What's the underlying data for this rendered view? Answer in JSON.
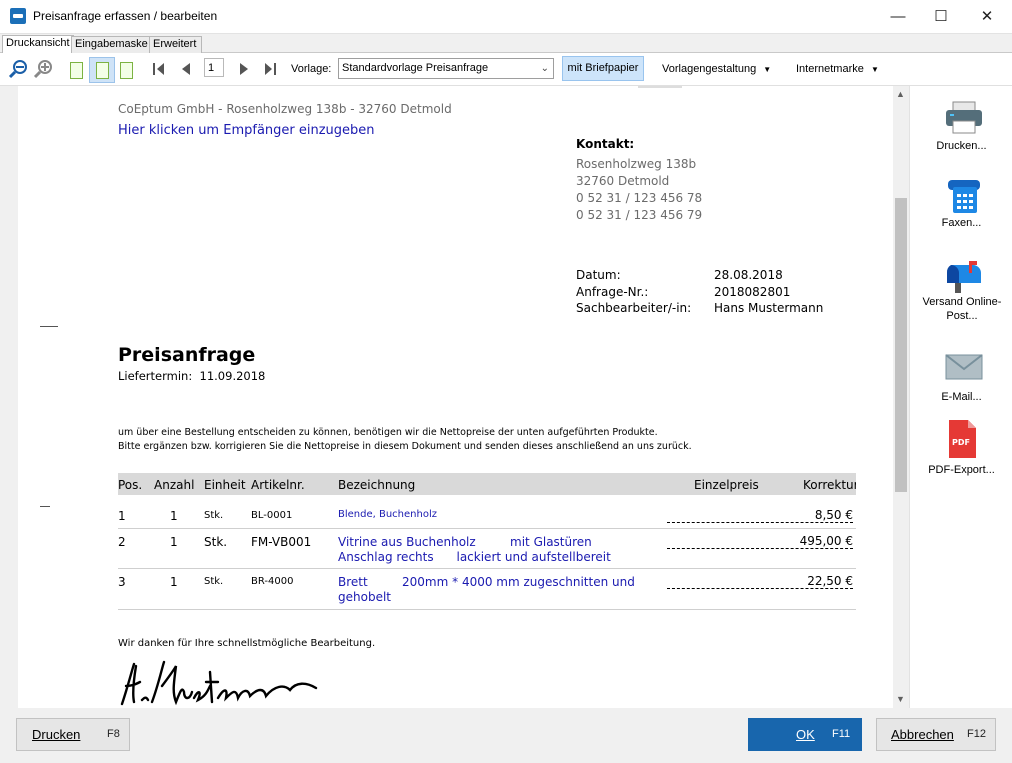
{
  "window": {
    "title": "Preisanfrage  erfassen / bearbeiten"
  },
  "tabs": [
    {
      "label": "Druckansicht"
    },
    {
      "label": "Eingabemaske"
    },
    {
      "label": "Erweitert"
    }
  ],
  "toolbar": {
    "page_number": "1",
    "vorlage_label": "Vorlage:",
    "vorlage_value": "Standardvorlage Preisanfrage",
    "briefpapier_label": "mit Briefpapier",
    "vorlagengestaltung_label": "Vorlagengestaltung",
    "internetmarke_label": "Internetmarke"
  },
  "document": {
    "sender_line": "CoEptum GmbH - Rosenholzweg 138b - 32760 Detmold",
    "recipient_placeholder": "Hier klicken um Empfänger einzugeben",
    "kontakt": {
      "title": "Kontakt:",
      "lines": [
        "Rosenholzweg 138b",
        "32760 Detmold",
        "0 52 31 / 123 456 78",
        "0 52 31 / 123 456 79"
      ]
    },
    "meta": [
      {
        "label": "Datum:",
        "value": "28.08.2018"
      },
      {
        "label": "Anfrage-Nr.:",
        "value": "2018082801"
      },
      {
        "label": "Sachbearbeiter/-in:",
        "value": "Hans Mustermann"
      }
    ],
    "heading": "Preisanfrage",
    "liefertermin_label": "Liefertermin:",
    "liefertermin_value": "11.09.2018",
    "intro_lines": [
      "um über eine Bestellung entscheiden zu können, benötigen wir die Nettopreise der unten aufgeführten Produkte.",
      "Bitte ergänzen bzw. korrigieren Sie die Nettopreise in diesem Dokument und senden dieses anschließend an uns zurück."
    ],
    "table": {
      "headers": [
        "Pos.",
        "Anzahl",
        "Einheit",
        "Artikelnr.",
        "Bezeichnung",
        "Einzelpreis",
        "Korrektur"
      ],
      "rows": [
        {
          "pos": "1",
          "anzahl": "1",
          "einheit": "Stk.",
          "artikelnr": "BL-0001",
          "bez1": "Blende, Buchenholz",
          "bez2": "",
          "price": "8,50 €"
        },
        {
          "pos": "2",
          "anzahl": "1",
          "einheit": "Stk.",
          "artikelnr": "FM-VB001",
          "bez1": "Vitrine aus Buchenholz         mit Glastüren",
          "bez2": "Anschlag rechts      lackiert und aufstellbereit",
          "price": "495,00 €"
        },
        {
          "pos": "3",
          "anzahl": "1",
          "einheit": "Stk.",
          "artikelnr": "BR-4000",
          "bez1": "Brett         200mm * 4000 mm zugeschnitten und",
          "bez2": "gehobelt",
          "price": "22,50 €"
        }
      ]
    },
    "thanks": "Wir danken für Ihre schnellstmögliche Bearbeitung."
  },
  "side_panel": [
    {
      "label": "Drucken...",
      "icon": "printer-icon"
    },
    {
      "label": "Faxen...",
      "icon": "fax-icon"
    },
    {
      "label": "Versand Online-Post...",
      "icon": "mailbox-icon"
    },
    {
      "label": "E-Mail...",
      "icon": "envelope-icon"
    },
    {
      "label": "PDF-Export...",
      "icon": "pdf-icon"
    }
  ],
  "buttons": {
    "drucken": {
      "label": "Drucken",
      "key": "F8"
    },
    "ok": {
      "label": "OK",
      "key": "F11"
    },
    "abbrechen": {
      "label": "Abbrechen",
      "key": "F12"
    }
  },
  "colors": {
    "accent": "#1866ad",
    "link_blue": "#1a1ab0",
    "pdf_red": "#e53935"
  }
}
